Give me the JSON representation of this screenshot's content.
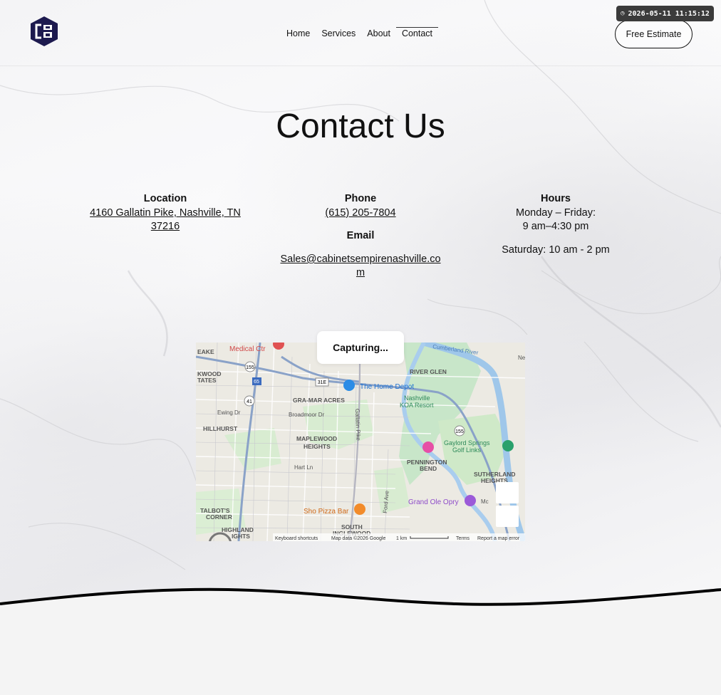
{
  "header": {
    "nav": [
      "Home",
      "Services",
      "About",
      "Contact"
    ],
    "active_nav": "Contact",
    "cta_label": "Free Estimate",
    "timestamp": "2026-05-11 11:15:12"
  },
  "page": {
    "title": "Contact Us"
  },
  "location": {
    "heading": "Location",
    "address_line1": "4160 Gallatin Pike, Nashville, TN",
    "address_line2": "37216"
  },
  "phone": {
    "heading": "Phone",
    "number": "(615) 205-7804"
  },
  "email": {
    "heading": "Email",
    "address_line1": "Sales@cabinetsempirenashville.co",
    "address_line2": "m"
  },
  "hours": {
    "heading": "Hours",
    "weekdays_line1": "Monday – Friday:",
    "weekdays_line2": "9 am–4:30 pm",
    "saturday": "Saturday: 10 am - 2 pm"
  },
  "overlay": {
    "capturing": "Capturing..."
  },
  "map": {
    "labels": {
      "medical": "Medical Ctr",
      "eake": "EAKE",
      "kwood": "KWOOD",
      "tates": "TATES",
      "river_glen": "RIVER GLEN",
      "home_depot": "The Home Depot",
      "gramar": "GRA-MAR ACRES",
      "koa1": "Nashville",
      "koa2": "KOA Resort",
      "ewing": "Ewing Dr",
      "broadmoor": "Broadmoor Dr",
      "gallatin": "Gallatin Pike",
      "hillhurst": "HILLHURST",
      "maplewood1": "MAPLEWOOD",
      "maplewood2": "HEIGHTS",
      "gaylord1": "Gaylord Springs",
      "gaylord2": "Golf Links",
      "pennington1": "PENNINGTON",
      "pennington2": "BEND",
      "hartln": "Hart Ln",
      "sutherland1": "SUTHERLAND",
      "sutherland2": "HEIGHTS",
      "grandole": "Grand Ole Opry",
      "shopizza": "Sho Pizza Bar",
      "talbot1": "TALBOT'S",
      "talbot2": "CORNER",
      "highland1": "HIGHLAND",
      "highland2": "IGHTS",
      "southingle1": "SOUTH",
      "southingle2": "INGLEWOOD",
      "cumberland": "Cumberland River",
      "fordave": "Ford Ave",
      "mo": "Mc",
      "neu": "Neu",
      "r155a": "155",
      "r155b": "155",
      "r65": "65",
      "r41": "41",
      "r31e": "31E"
    },
    "attribution": {
      "shortcuts": "Keyboard shortcuts",
      "mapdata": "Map data ©2026 Google",
      "scale": "1 km",
      "terms": "Terms",
      "report": "Report a map error"
    }
  }
}
